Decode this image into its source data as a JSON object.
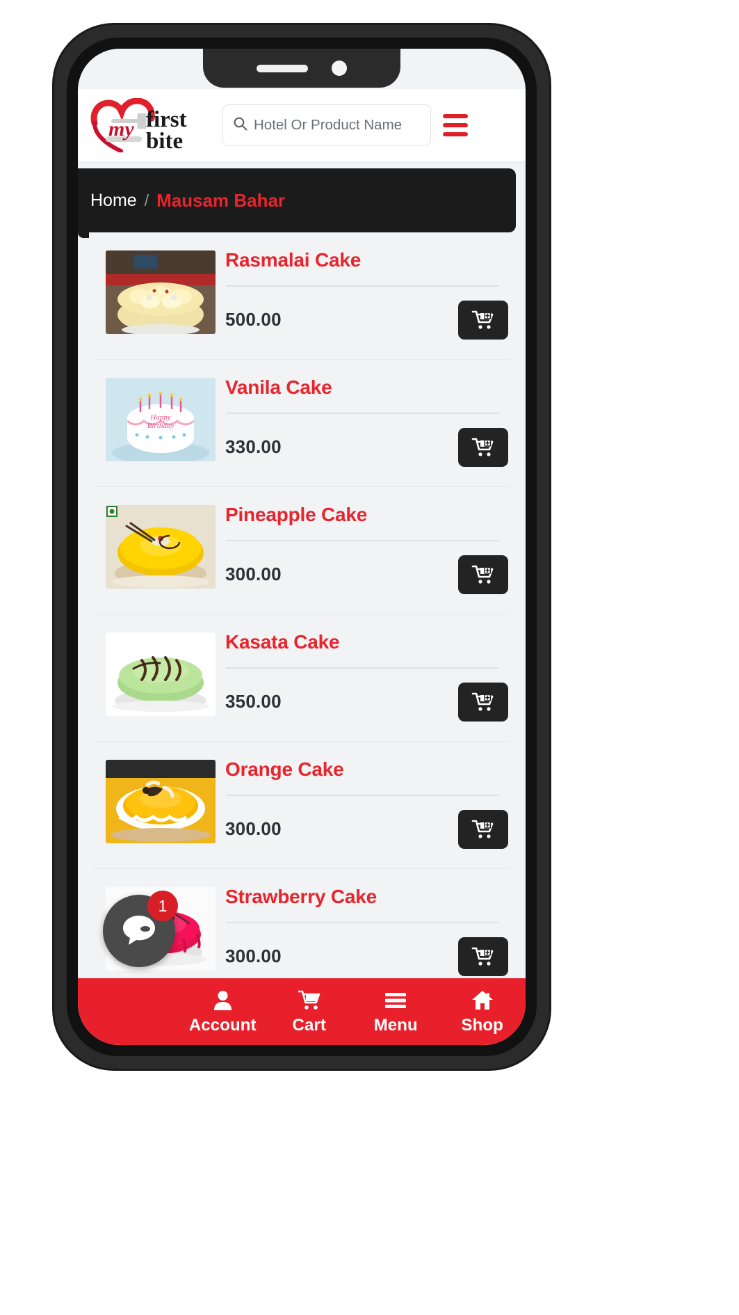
{
  "brand": {
    "logo_text_my": "my",
    "logo_text_first": "first",
    "logo_text_bite": "bite",
    "accent_red": "#e8242c",
    "nav_red": "#e8202b",
    "dark": "#1b1b1b"
  },
  "header": {
    "search_placeholder": "Hotel Or Product Name",
    "search_value": "",
    "menu_icon": "hamburger-icon",
    "search_icon": "search-icon"
  },
  "breadcrumb": {
    "home_label": "Home",
    "separator": "/",
    "current_label": "Mausam Bahar"
  },
  "products": [
    {
      "name": "Rasmalai Cake",
      "price": "500.00",
      "image": "rasmalai-cake-photo",
      "cart_icon": "cart-plus-icon"
    },
    {
      "name": "Vanila Cake",
      "price": "330.00",
      "image": "vanila-cake-photo",
      "cart_icon": "cart-plus-icon"
    },
    {
      "name": "Pineapple Cake",
      "price": "300.00",
      "image": "pineapple-cake-photo",
      "cart_icon": "cart-plus-icon"
    },
    {
      "name": "Kasata Cake",
      "price": "350.00",
      "image": "kasata-cake-photo",
      "cart_icon": "cart-plus-icon"
    },
    {
      "name": "Orange Cake",
      "price": "300.00",
      "image": "orange-cake-photo",
      "cart_icon": "cart-plus-icon"
    },
    {
      "name": "Strawberry Cake",
      "price": "300.00",
      "image": "strawberry-cake-photo",
      "cart_icon": "cart-plus-icon"
    }
  ],
  "chat": {
    "badge_count": "1",
    "icon": "chat-bubble-icon"
  },
  "bottom_nav": [
    {
      "label": "Account",
      "icon": "user-icon"
    },
    {
      "label": "Cart",
      "icon": "shopping-cart-icon"
    },
    {
      "label": "Menu",
      "icon": "hamburger-icon"
    },
    {
      "label": "Shop",
      "icon": "home-icon"
    }
  ]
}
